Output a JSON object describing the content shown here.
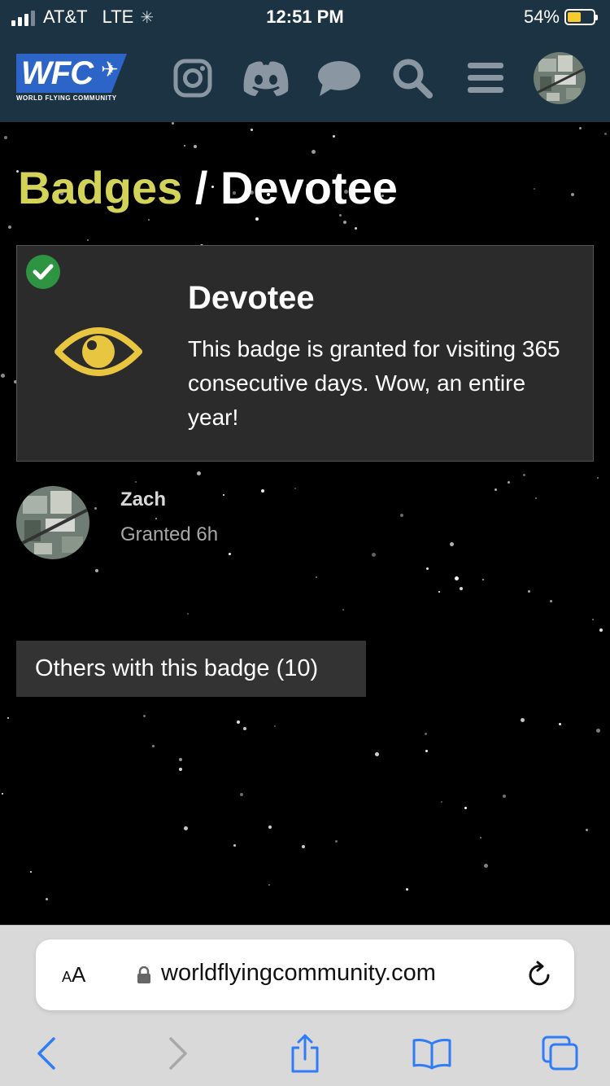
{
  "status_bar": {
    "carrier": "AT&T",
    "network": "LTE",
    "time": "12:51 PM",
    "battery_percent": "54%",
    "battery_level": 0.54
  },
  "header": {
    "logo_text": "WFC",
    "logo_subtitle": "WORLD FLYING COMMUNITY",
    "icons": [
      "instagram-icon",
      "discord-icon",
      "chat-icon",
      "search-icon",
      "menu-icon",
      "user-avatar"
    ]
  },
  "breadcrumb": {
    "parent": "Badges",
    "separator": " / ",
    "current": "Devotee"
  },
  "badge": {
    "name": "Devotee",
    "description": "This badge is granted for visiting 365 consecutive days. Wow, an entire year!",
    "icon": "eye-icon",
    "granted_icon": "check-circle-icon",
    "icon_color": "#e8c640",
    "check_color": "#2e9442"
  },
  "grant": {
    "username": "Zach",
    "time_label": "Granted 6h"
  },
  "others_button": {
    "label": "Others with this badge (10)"
  },
  "safari": {
    "text_size_label_small": "A",
    "text_size_label_large": "A",
    "url": "worldflyingcommunity.com"
  },
  "colors": {
    "header_bg": "#1c3344",
    "breadcrumb_link": "#d3d35a",
    "card_bg": "#2b2b2b",
    "safari_link": "#2f7cf6"
  }
}
